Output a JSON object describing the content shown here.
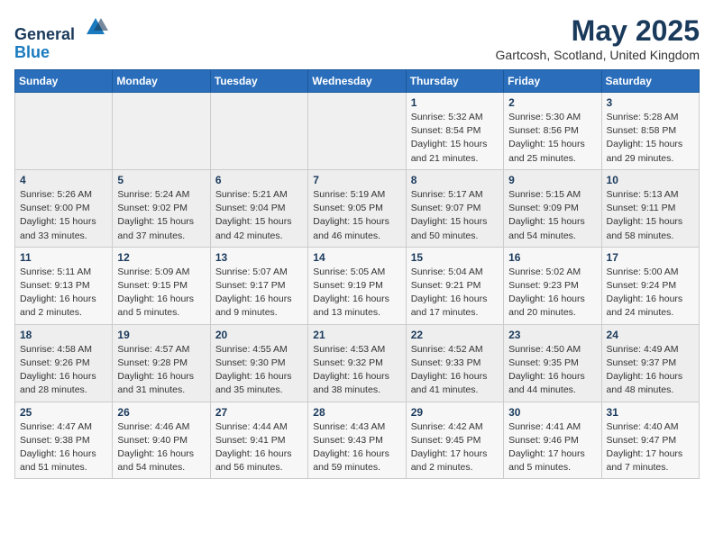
{
  "header": {
    "logo_line1": "General",
    "logo_line2": "Blue",
    "month_year": "May 2025",
    "location": "Gartcosh, Scotland, United Kingdom"
  },
  "days_of_week": [
    "Sunday",
    "Monday",
    "Tuesday",
    "Wednesday",
    "Thursday",
    "Friday",
    "Saturday"
  ],
  "weeks": [
    [
      {
        "num": "",
        "info": ""
      },
      {
        "num": "",
        "info": ""
      },
      {
        "num": "",
        "info": ""
      },
      {
        "num": "",
        "info": ""
      },
      {
        "num": "1",
        "info": "Sunrise: 5:32 AM\nSunset: 8:54 PM\nDaylight: 15 hours\nand 21 minutes."
      },
      {
        "num": "2",
        "info": "Sunrise: 5:30 AM\nSunset: 8:56 PM\nDaylight: 15 hours\nand 25 minutes."
      },
      {
        "num": "3",
        "info": "Sunrise: 5:28 AM\nSunset: 8:58 PM\nDaylight: 15 hours\nand 29 minutes."
      }
    ],
    [
      {
        "num": "4",
        "info": "Sunrise: 5:26 AM\nSunset: 9:00 PM\nDaylight: 15 hours\nand 33 minutes."
      },
      {
        "num": "5",
        "info": "Sunrise: 5:24 AM\nSunset: 9:02 PM\nDaylight: 15 hours\nand 37 minutes."
      },
      {
        "num": "6",
        "info": "Sunrise: 5:21 AM\nSunset: 9:04 PM\nDaylight: 15 hours\nand 42 minutes."
      },
      {
        "num": "7",
        "info": "Sunrise: 5:19 AM\nSunset: 9:05 PM\nDaylight: 15 hours\nand 46 minutes."
      },
      {
        "num": "8",
        "info": "Sunrise: 5:17 AM\nSunset: 9:07 PM\nDaylight: 15 hours\nand 50 minutes."
      },
      {
        "num": "9",
        "info": "Sunrise: 5:15 AM\nSunset: 9:09 PM\nDaylight: 15 hours\nand 54 minutes."
      },
      {
        "num": "10",
        "info": "Sunrise: 5:13 AM\nSunset: 9:11 PM\nDaylight: 15 hours\nand 58 minutes."
      }
    ],
    [
      {
        "num": "11",
        "info": "Sunrise: 5:11 AM\nSunset: 9:13 PM\nDaylight: 16 hours\nand 2 minutes."
      },
      {
        "num": "12",
        "info": "Sunrise: 5:09 AM\nSunset: 9:15 PM\nDaylight: 16 hours\nand 5 minutes."
      },
      {
        "num": "13",
        "info": "Sunrise: 5:07 AM\nSunset: 9:17 PM\nDaylight: 16 hours\nand 9 minutes."
      },
      {
        "num": "14",
        "info": "Sunrise: 5:05 AM\nSunset: 9:19 PM\nDaylight: 16 hours\nand 13 minutes."
      },
      {
        "num": "15",
        "info": "Sunrise: 5:04 AM\nSunset: 9:21 PM\nDaylight: 16 hours\nand 17 minutes."
      },
      {
        "num": "16",
        "info": "Sunrise: 5:02 AM\nSunset: 9:23 PM\nDaylight: 16 hours\nand 20 minutes."
      },
      {
        "num": "17",
        "info": "Sunrise: 5:00 AM\nSunset: 9:24 PM\nDaylight: 16 hours\nand 24 minutes."
      }
    ],
    [
      {
        "num": "18",
        "info": "Sunrise: 4:58 AM\nSunset: 9:26 PM\nDaylight: 16 hours\nand 28 minutes."
      },
      {
        "num": "19",
        "info": "Sunrise: 4:57 AM\nSunset: 9:28 PM\nDaylight: 16 hours\nand 31 minutes."
      },
      {
        "num": "20",
        "info": "Sunrise: 4:55 AM\nSunset: 9:30 PM\nDaylight: 16 hours\nand 35 minutes."
      },
      {
        "num": "21",
        "info": "Sunrise: 4:53 AM\nSunset: 9:32 PM\nDaylight: 16 hours\nand 38 minutes."
      },
      {
        "num": "22",
        "info": "Sunrise: 4:52 AM\nSunset: 9:33 PM\nDaylight: 16 hours\nand 41 minutes."
      },
      {
        "num": "23",
        "info": "Sunrise: 4:50 AM\nSunset: 9:35 PM\nDaylight: 16 hours\nand 44 minutes."
      },
      {
        "num": "24",
        "info": "Sunrise: 4:49 AM\nSunset: 9:37 PM\nDaylight: 16 hours\nand 48 minutes."
      }
    ],
    [
      {
        "num": "25",
        "info": "Sunrise: 4:47 AM\nSunset: 9:38 PM\nDaylight: 16 hours\nand 51 minutes."
      },
      {
        "num": "26",
        "info": "Sunrise: 4:46 AM\nSunset: 9:40 PM\nDaylight: 16 hours\nand 54 minutes."
      },
      {
        "num": "27",
        "info": "Sunrise: 4:44 AM\nSunset: 9:41 PM\nDaylight: 16 hours\nand 56 minutes."
      },
      {
        "num": "28",
        "info": "Sunrise: 4:43 AM\nSunset: 9:43 PM\nDaylight: 16 hours\nand 59 minutes."
      },
      {
        "num": "29",
        "info": "Sunrise: 4:42 AM\nSunset: 9:45 PM\nDaylight: 17 hours\nand 2 minutes."
      },
      {
        "num": "30",
        "info": "Sunrise: 4:41 AM\nSunset: 9:46 PM\nDaylight: 17 hours\nand 5 minutes."
      },
      {
        "num": "31",
        "info": "Sunrise: 4:40 AM\nSunset: 9:47 PM\nDaylight: 17 hours\nand 7 minutes."
      }
    ]
  ]
}
